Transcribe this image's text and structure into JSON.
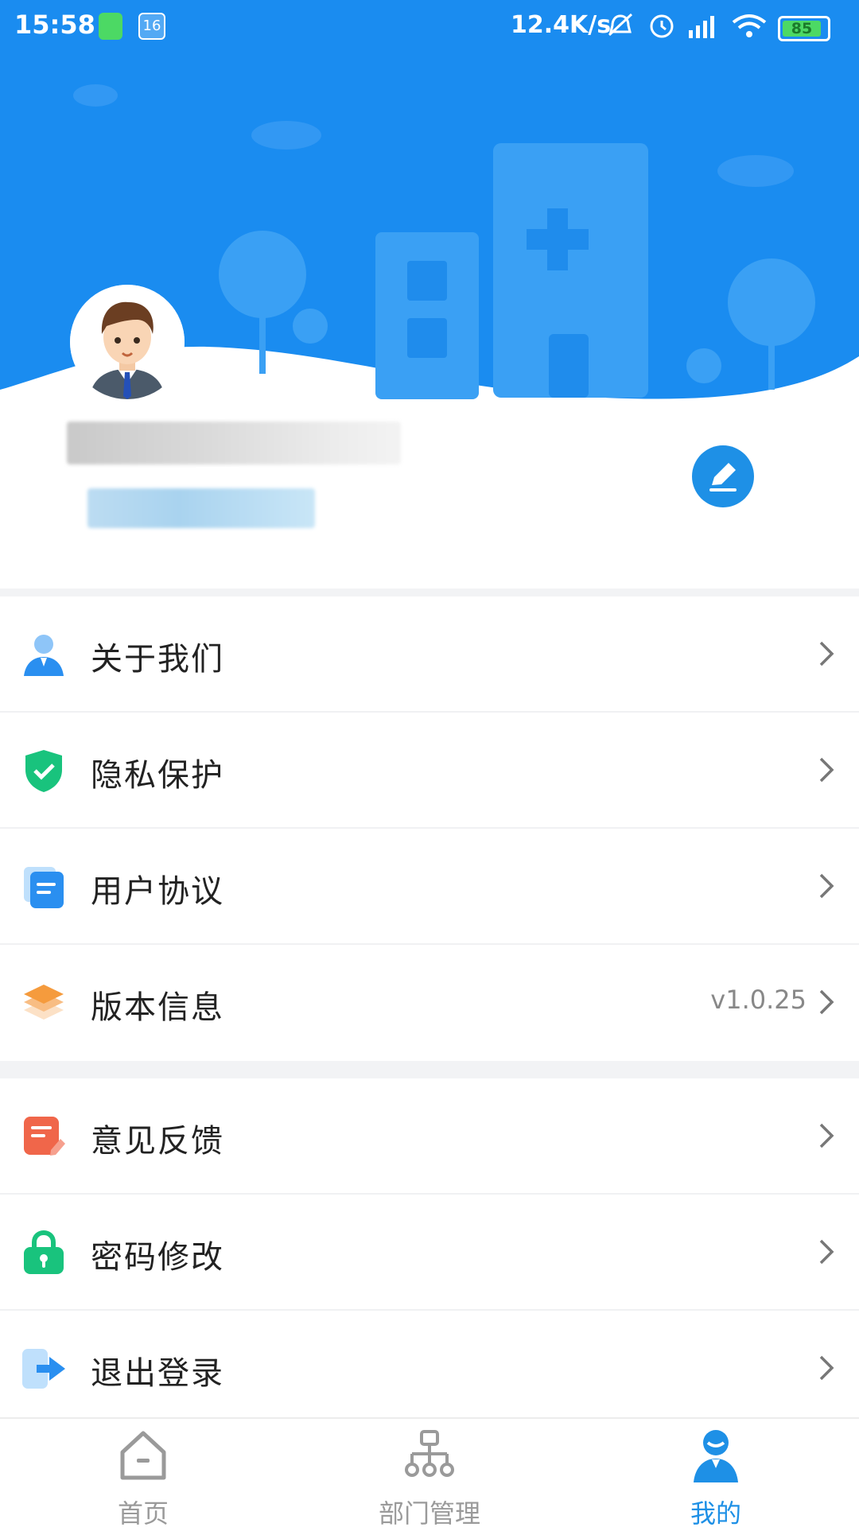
{
  "status_bar": {
    "time": "15:58",
    "notification_count": "16",
    "net_speed": "12.4K/s",
    "battery": "85"
  },
  "header": {
    "username": "",
    "organization": ""
  },
  "menu": {
    "group1": [
      {
        "label": "关于我们",
        "icon": "user-tie-icon",
        "color": "#2a8ff0"
      },
      {
        "label": "隐私保护",
        "icon": "shield-check-icon",
        "color": "#19c37d"
      },
      {
        "label": "用户协议",
        "icon": "document-icon",
        "color": "#2a8ff0"
      },
      {
        "label": "版本信息",
        "icon": "layers-icon",
        "color": "#f59b3d",
        "value": "v1.0.25"
      }
    ],
    "group2": [
      {
        "label": "意见反馈",
        "icon": "feedback-icon",
        "color": "#f0664a"
      },
      {
        "label": "密码修改",
        "icon": "lock-icon",
        "color": "#19c37d"
      },
      {
        "label": "退出登录",
        "icon": "logout-icon",
        "color": "#2a8ff0"
      }
    ]
  },
  "tabs": [
    {
      "label": "首页",
      "icon": "home-icon"
    },
    {
      "label": "部门管理",
      "icon": "org-chart-icon"
    },
    {
      "label": "我的",
      "icon": "profile-icon",
      "active": true
    }
  ],
  "colors": {
    "primary": "#1e90e6",
    "header_bg": "#1a8cf0",
    "inactive": "#9a9a9a"
  }
}
